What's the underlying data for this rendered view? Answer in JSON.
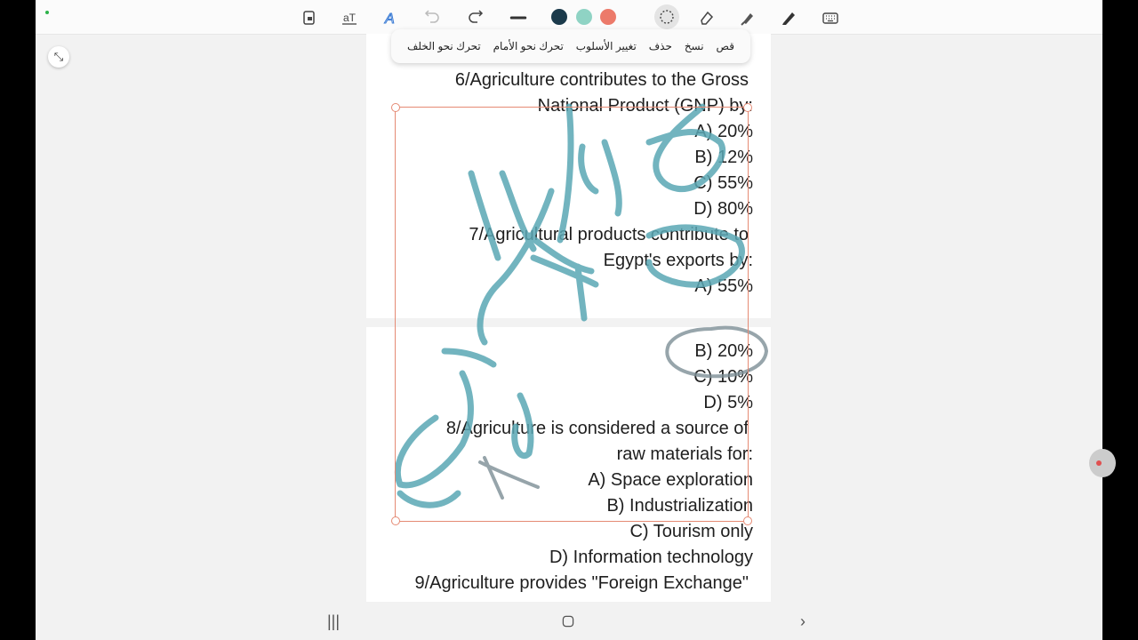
{
  "toolbar": {
    "icons": [
      "lock-file-icon",
      "text-format-icon",
      "handwriting-to-text-icon",
      "undo-icon",
      "redo-icon",
      "pen-thickness-icon",
      "color-black",
      "color-teal",
      "color-red",
      "lasso-select-icon",
      "eraser-icon",
      "highlighter-icon",
      "pen-icon",
      "keyboard-icon"
    ],
    "colors": {
      "black": "#1b3a4b",
      "teal": "#8fd3c4",
      "red": "#ec7a6a"
    }
  },
  "context_menu": {
    "items": [
      "قص",
      "نسخ",
      "حذف",
      "تغيير الأسلوب",
      "تحرك نحو الأمام",
      "تحرك نحو الخلف"
    ]
  },
  "document": {
    "page1_lines": [
      "6/Agriculture contributes to the Gross",
      "National Product (GNP) by:",
      "A) 20%",
      "B) 12%",
      "C) 55%",
      "D) 80%",
      "7/Agricultural products contribute to",
      "Egypt's exports by:",
      "A) 55%"
    ],
    "page2_lines": [
      "B) 20%",
      "C) 10%",
      "D) 5%",
      "8/Agriculture is considered a source of",
      "raw materials for:",
      "A) Space exploration",
      "B) Industrialization",
      "C) Tourism only",
      "D) Information technology",
      "9/Agriculture provides \"Foreign Exchange\""
    ]
  },
  "ink": {
    "color": "#5aa7b4"
  },
  "navigation": {
    "recent": "|||",
    "home": "○",
    "back": "›"
  }
}
